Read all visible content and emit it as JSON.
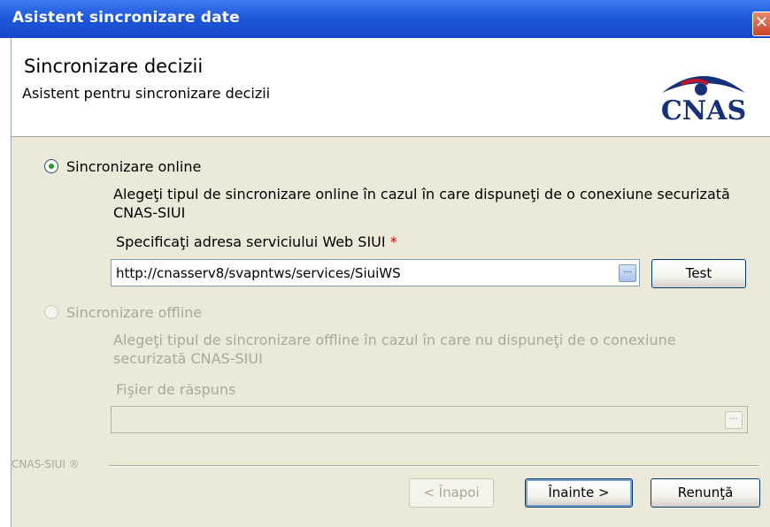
{
  "window": {
    "title": "Asistent sincronizare date",
    "close_glyph": "✕"
  },
  "header": {
    "title": "Sincronizare decizii",
    "subtitle": "Asistent pentru sincronizare decizii",
    "logo_text": "CNAS",
    "logo_colors": {
      "navy": "#16307a",
      "red": "#c4142b"
    }
  },
  "online": {
    "label": "Sincronizare online",
    "checked": true,
    "description": "Alegeţi tipul de sincronizare online în cazul în care dispuneţi de o conexiune securizată CNAS-SIUI",
    "url_label": "Specificaţi adresa serviciului Web SIUI",
    "required_mark": "*",
    "url_value": "http://cnasserv8/svapntws/services/SiuiWS",
    "browse_label": "...",
    "test_button": "Test"
  },
  "offline": {
    "label": "Sincronizare offline",
    "checked": false,
    "description": "Alegeţi tipul de sincronizare offline în cazul în care nu dispuneţi de o conexiune securizată CNAS-SIUI",
    "file_label": "Fişier de răspuns",
    "file_value": "",
    "browse_label": "..."
  },
  "footer": {
    "brand": "CNAS-SIUI ®",
    "back_button": "< Înapoi",
    "next_button": "Înainte >",
    "cancel_button": "Renunţă"
  }
}
